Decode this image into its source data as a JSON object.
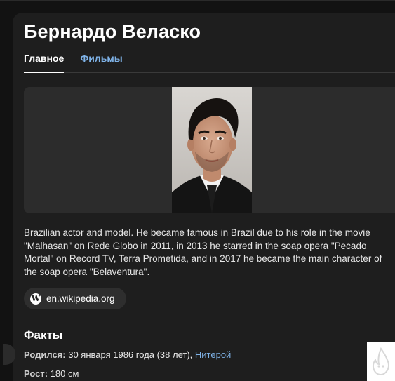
{
  "person": {
    "name": "Бернардо Веласко"
  },
  "tabs": [
    {
      "label": "Главное",
      "active": true
    },
    {
      "label": "Фильмы",
      "active": false
    }
  ],
  "description": "Brazilian actor and model. He became famous in Brazil due to his role in the movie \"Malhasan\" on Rede Globo in 2011, in 2013 he starred in the soap opera \"Pecado Mortal\" on Record TV, Terra Prometida, and in 2017 he became the main character of the soap opera \"Belaventura\".",
  "source": {
    "icon": "wikipedia-icon",
    "icon_glyph": "W",
    "label": "en.wikipedia.org"
  },
  "facts": {
    "heading": "Факты",
    "born": {
      "label": "Родился:",
      "value": "30 января 1986 года (38 лет),",
      "place": "Нитерой"
    },
    "height": {
      "label": "Рост:",
      "value": "180 см"
    }
  },
  "colors": {
    "background": "#121212",
    "card": "#1e1e1e",
    "link": "#7fb3e8",
    "text": "#e6e6e6"
  }
}
